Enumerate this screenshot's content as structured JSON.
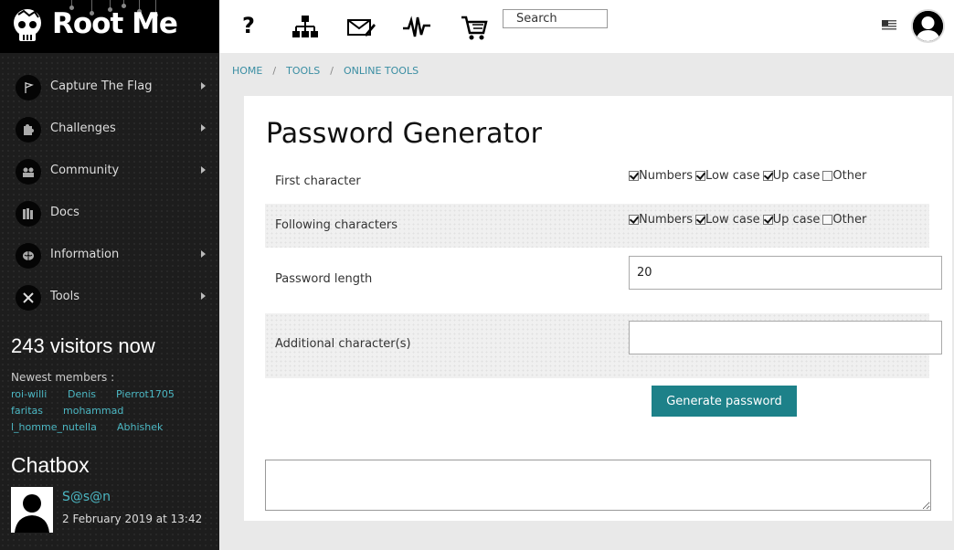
{
  "logo": {
    "text": "Root Me"
  },
  "sidebar": {
    "items": [
      {
        "label": "Capture The Flag",
        "icon": "flag-icon",
        "has_submenu": true
      },
      {
        "label": "Challenges",
        "icon": "puzzle-icon",
        "has_submenu": true
      },
      {
        "label": "Community",
        "icon": "people-icon",
        "has_submenu": true
      },
      {
        "label": "Docs",
        "icon": "books-icon",
        "has_submenu": false
      },
      {
        "label": "Information",
        "icon": "brain-icon",
        "has_submenu": true
      },
      {
        "label": "Tools",
        "icon": "tools-icon",
        "has_submenu": true
      }
    ],
    "visitors": "243 visitors now",
    "newest_label": "Newest members :",
    "members": [
      "roi-willi",
      "Denis",
      "Pierrot1705",
      "faritas",
      "mohammad",
      "l_homme_nutella",
      "Abhishek"
    ],
    "chatbox_title": "Chatbox",
    "chat": {
      "user": "S@s@n",
      "time": "2 February 2019 at 13:42"
    }
  },
  "topbar": {
    "icons": [
      "help-icon",
      "sitemap-icon",
      "mail-icon",
      "activity-icon",
      "cart-icon"
    ],
    "help_glyph": "?",
    "search_placeholder": "Search"
  },
  "breadcrumb": [
    "HOME",
    "TOOLS",
    "ONLINE TOOLS"
  ],
  "form": {
    "title": "Password Generator",
    "first_character": {
      "label": "First character",
      "options": [
        {
          "label": "Numbers",
          "checked": true
        },
        {
          "label": "Low case",
          "checked": true
        },
        {
          "label": "Up case",
          "checked": true
        },
        {
          "label": "Other",
          "checked": false
        }
      ]
    },
    "following_characters": {
      "label": "Following characters",
      "options": [
        {
          "label": "Numbers",
          "checked": true
        },
        {
          "label": "Low case",
          "checked": true
        },
        {
          "label": "Up case",
          "checked": true
        },
        {
          "label": "Other",
          "checked": false
        }
      ]
    },
    "password_length": {
      "label": "Password length",
      "value": "20"
    },
    "additional_characters": {
      "label": "Additional character(s)",
      "value": ""
    },
    "generate_label": "Generate password",
    "result_value": ""
  },
  "colors": {
    "accent": "#1d8189",
    "link": "#4cb8c4",
    "sidebar_bg": "#1d1d1d"
  }
}
